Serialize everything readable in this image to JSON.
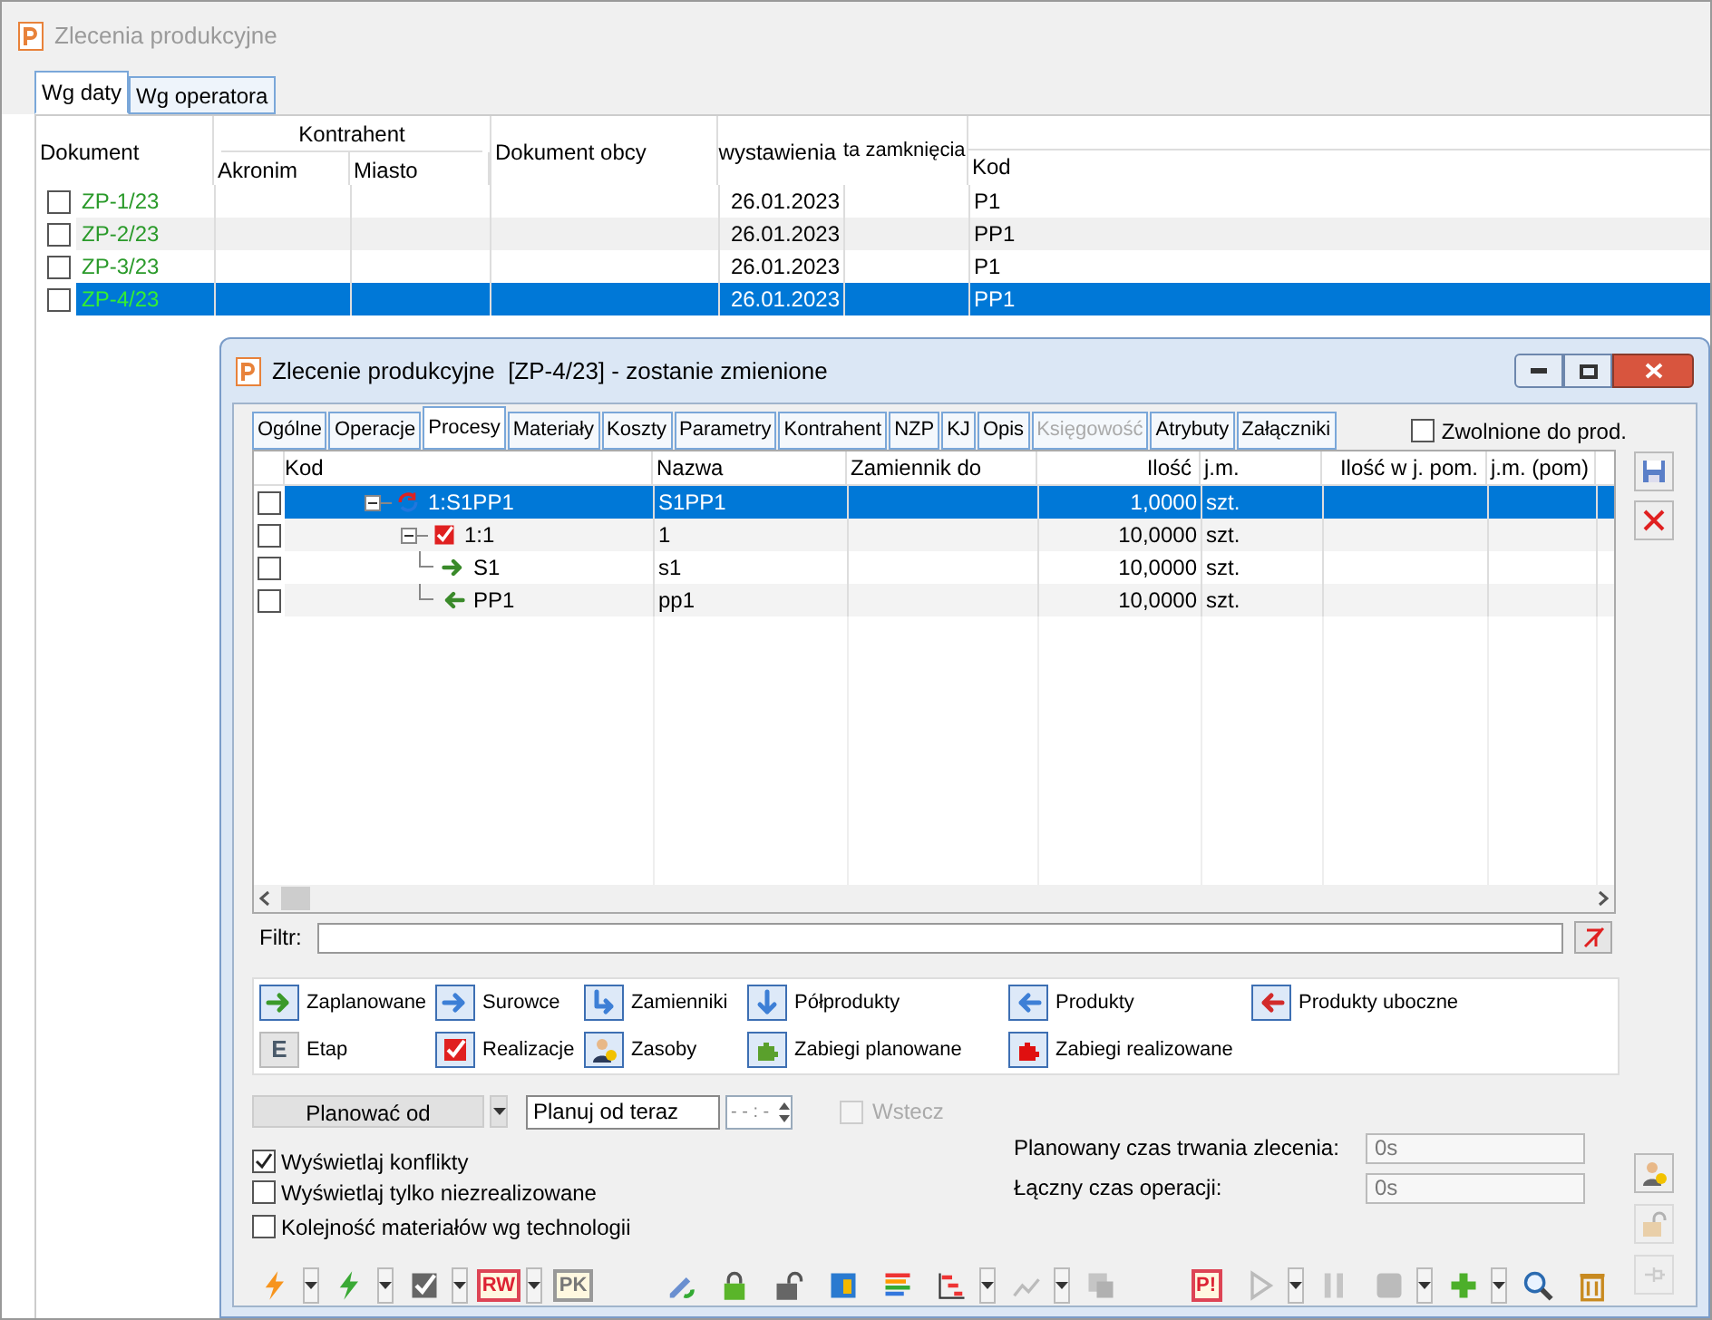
{
  "window": {
    "title": "Zlecenia produkcyjne"
  },
  "tabs": [
    {
      "label": "Wg daty",
      "selected": true
    },
    {
      "label": "Wg operatora",
      "selected": false
    }
  ],
  "list": {
    "group_header": "Kontrahent",
    "columns": [
      "Dokument",
      "Akronim",
      "Miasto",
      "Dokument obcy",
      "wystawienia",
      "ta zamknięcia",
      "Kod"
    ],
    "rows": [
      {
        "document": "ZP-1/23",
        "date": "26.01.2023",
        "code": "P1",
        "checked": false,
        "selected": false
      },
      {
        "document": "ZP-2/23",
        "date": "26.01.2023",
        "code": "PP1",
        "checked": false,
        "selected": false
      },
      {
        "document": "ZP-3/23",
        "date": "26.01.2023",
        "code": "P1",
        "checked": false,
        "selected": false
      },
      {
        "document": "ZP-4/23",
        "date": "26.01.2023",
        "code": "PP1",
        "checked": false,
        "selected": true
      }
    ]
  },
  "dialog": {
    "title": "Zlecenie produkcyjne  [ZP-4/23] - zostanie zmienione",
    "tabs": [
      {
        "label": "Ogólne",
        "selected": false,
        "disabled": false
      },
      {
        "label": "Operacje",
        "selected": false,
        "disabled": false
      },
      {
        "label": "Procesy",
        "selected": true,
        "disabled": false
      },
      {
        "label": "Materiały",
        "selected": false,
        "disabled": false
      },
      {
        "label": "Koszty",
        "selected": false,
        "disabled": false
      },
      {
        "label": "Parametry",
        "selected": false,
        "disabled": false
      },
      {
        "label": "Kontrahent",
        "selected": false,
        "disabled": false
      },
      {
        "label": "NZP",
        "selected": false,
        "disabled": false
      },
      {
        "label": "KJ",
        "selected": false,
        "disabled": false
      },
      {
        "label": "Opis",
        "selected": false,
        "disabled": false
      },
      {
        "label": "Księgowość",
        "selected": false,
        "disabled": true
      },
      {
        "label": "Atrybuty",
        "selected": false,
        "disabled": false
      },
      {
        "label": "Załączniki",
        "selected": false,
        "disabled": false
      }
    ],
    "released": {
      "label": "Zwolnione do prod.",
      "checked": false
    },
    "grid": {
      "columns": [
        "Kod",
        "Nazwa",
        "Zamiennik do",
        "Ilość",
        "j.m.",
        "Ilość w j. pom.",
        "j.m. (pom)"
      ],
      "rows": [
        {
          "code": "1:S1PP1",
          "name": "S1PP1",
          "qty": "1,0000",
          "unit": "szt.",
          "kind": "cycle",
          "checked": false,
          "selected": true,
          "expanded": true,
          "children": [
            {
              "code": "1:1",
              "name": "1",
              "qty": "10,0000",
              "unit": "szt.",
              "kind": "check",
              "checked": false,
              "selected": false,
              "expanded": true,
              "children": [
                {
                  "code": "S1",
                  "name": "s1",
                  "qty": "10,0000",
                  "unit": "szt.",
                  "kind": "arrow-right",
                  "checked": false,
                  "selected": false
                },
                {
                  "code": "PP1",
                  "name": "pp1",
                  "qty": "10,0000",
                  "unit": "szt.",
                  "kind": "arrow-left",
                  "checked": false,
                  "selected": false
                }
              ]
            }
          ]
        }
      ]
    },
    "filter": {
      "label": "Filtr:"
    },
    "legend": [
      {
        "kind": "arrow-right",
        "color": "#3a9a2a",
        "label": "Zaplanowane"
      },
      {
        "kind": "arrow-right",
        "color": "#3d7fd6",
        "label": "Surowce"
      },
      {
        "kind": "turn",
        "color": "#3d7fd6",
        "label": "Zamienniki"
      },
      {
        "kind": "arrow-down",
        "color": "#3d7fd6",
        "label": "Półprodukty"
      },
      {
        "kind": "arrow-left",
        "color": "#3d7fd6",
        "label": "Produkty"
      },
      {
        "kind": "arrow-left",
        "color": "#d22a2a",
        "label": "Produkty uboczne"
      },
      {
        "kind": "letter",
        "color": "#4a5a6a",
        "icon_text": "E",
        "label": "Etap"
      },
      {
        "kind": "check",
        "color": "#e02020",
        "label": "Realizacje"
      },
      {
        "kind": "person",
        "color": "#2a3a5a",
        "label": "Zasoby"
      },
      {
        "kind": "puzzle",
        "color": "#5aa02c",
        "label": "Zabiegi planowane"
      },
      {
        "kind": "puzzle",
        "color": "#e01010",
        "label": "Zabiegi realizowane"
      }
    ],
    "plan": {
      "button": "Planować od",
      "mode": "Planuj od teraz",
      "time": "- - : -",
      "back": {
        "label": "Wstecz",
        "checked": false,
        "disabled": true
      }
    },
    "options": [
      {
        "label": "Wyświetlaj konflikty",
        "checked": true
      },
      {
        "label": "Wyświetlaj tylko niezrealizowane",
        "checked": false
      },
      {
        "label": "Kolejność materiałów wg technologii",
        "checked": false
      }
    ],
    "durations": [
      {
        "label": "Planowany czas trwania zlecenia:",
        "value": "0s"
      },
      {
        "label": "Łączny czas operacji:",
        "value": "0s"
      }
    ],
    "toolbar": [
      {
        "items": [
          {
            "kind": "bolt",
            "color": "#f7941d",
            "dropdown": true,
            "disabled": false
          },
          {
            "kind": "bolt",
            "color": "#3aa935",
            "dropdown": true,
            "disabled": false
          },
          {
            "kind": "check",
            "dropdown": true,
            "disabled": false
          },
          {
            "kind": "text",
            "label": "RW",
            "dropdown": true,
            "disabled": false
          },
          {
            "kind": "text",
            "label": "PK",
            "dropdown": false,
            "disabled": true
          }
        ]
      },
      {
        "items": [
          {
            "kind": "pen-refresh",
            "dropdown": false,
            "disabled": false
          },
          {
            "kind": "lock-closed",
            "dropdown": false,
            "disabled": false
          },
          {
            "kind": "lock-open",
            "dropdown": false,
            "disabled": false
          },
          {
            "kind": "door",
            "dropdown": false,
            "disabled": false
          },
          {
            "kind": "bars",
            "dropdown": false,
            "disabled": false
          },
          {
            "kind": "gantt",
            "dropdown": true,
            "disabled": false
          },
          {
            "kind": "chart",
            "dropdown": true,
            "disabled": true
          },
          {
            "kind": "windows",
            "dropdown": false,
            "disabled": true
          }
        ]
      },
      {
        "items": [
          {
            "kind": "text",
            "label": "P!",
            "dropdown": false,
            "disabled": false
          },
          {
            "kind": "play",
            "dropdown": true,
            "disabled": true
          },
          {
            "kind": "pause",
            "dropdown": false,
            "disabled": true
          },
          {
            "kind": "stop",
            "dropdown": true,
            "disabled": true
          },
          {
            "kind": "plus",
            "dropdown": true,
            "disabled": false
          },
          {
            "kind": "search",
            "dropdown": false,
            "disabled": false
          },
          {
            "kind": "trash",
            "dropdown": false,
            "disabled": false
          }
        ]
      }
    ],
    "side_top": [
      {
        "kind": "save",
        "disabled": false
      },
      {
        "kind": "delete",
        "disabled": false
      }
    ],
    "side_bottom": [
      {
        "kind": "person",
        "disabled": false
      },
      {
        "kind": "lock-open",
        "disabled": true
      },
      {
        "kind": "pin",
        "disabled": true
      }
    ]
  }
}
